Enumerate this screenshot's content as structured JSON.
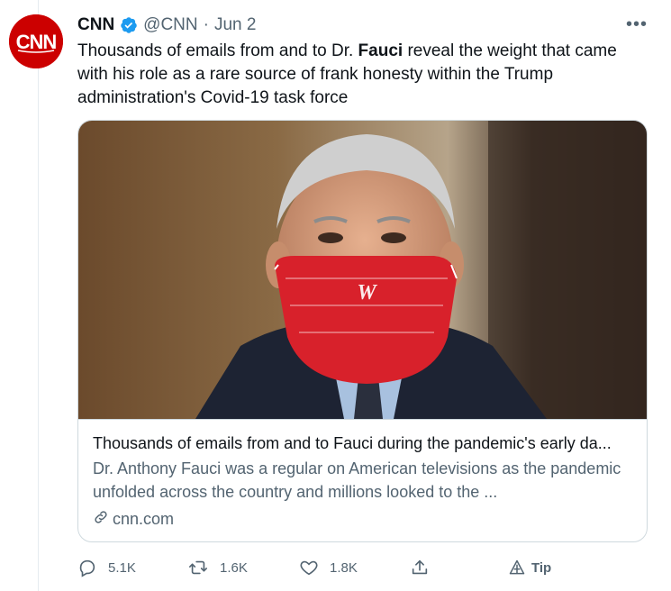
{
  "tweet": {
    "author_name": "CNN",
    "handle": "@CNN",
    "separator": "·",
    "date": "Jun 2",
    "text_part1": "Thousands of emails from and to Dr. ",
    "text_bold": "Fauci",
    "text_part2": " reveal the weight that came with his role as a rare source of frank honesty within the Trump administration's Covid-19 task force",
    "more_label": "•••",
    "avatar_logo": "CNN"
  },
  "card": {
    "title": "Thousands of emails from and to Fauci during the pandemic's early da...",
    "description": "Dr. Anthony Fauci was a regular on American televisions as the pandemic unfolded across the country and millions looked to the ...",
    "domain": "cnn.com"
  },
  "actions": {
    "reply_count": "5.1K",
    "retweet_count": "1.6K",
    "like_count": "1.8K",
    "tip_label": "Tip"
  },
  "colors": {
    "brand_red": "#cc0000",
    "verified_blue": "#1d9bf0",
    "secondary_text": "#536471",
    "border": "#cfd9de"
  }
}
